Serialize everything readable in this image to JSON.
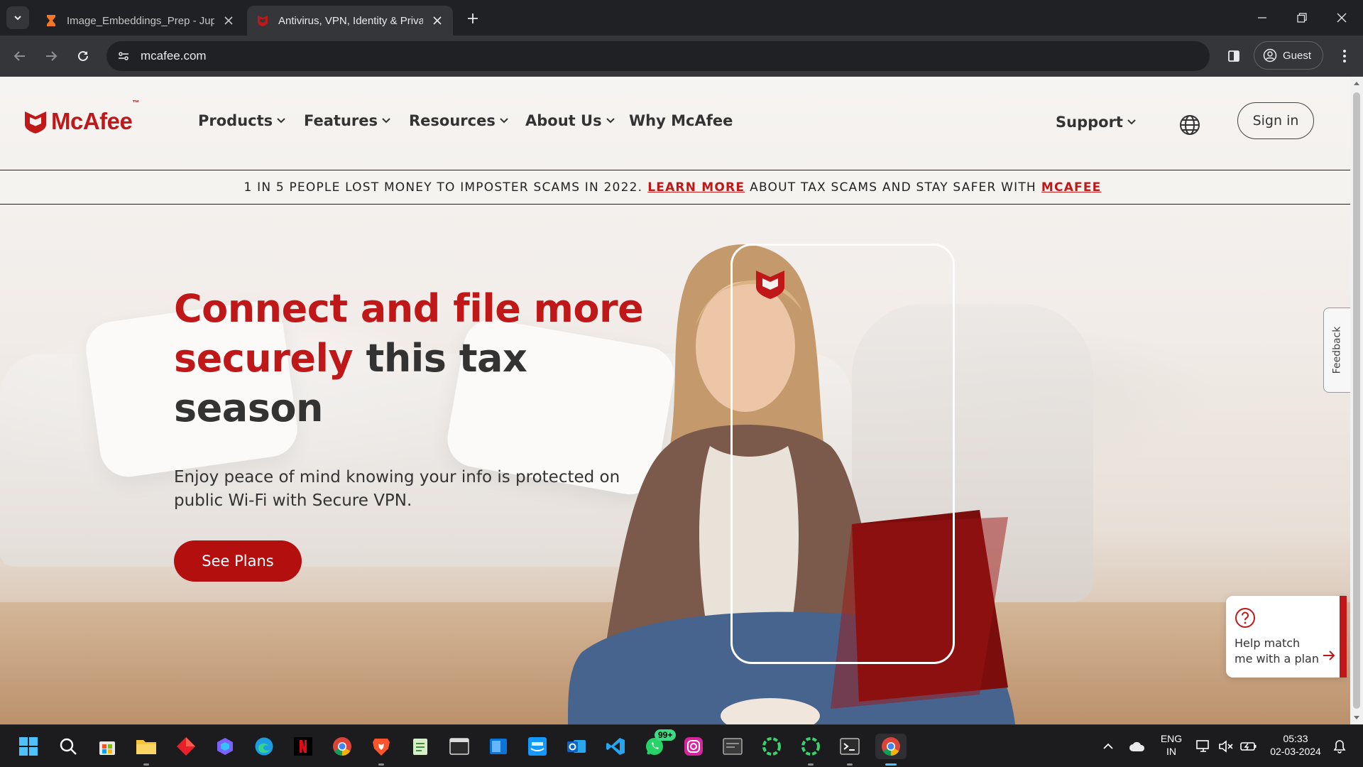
{
  "browser": {
    "tabs": [
      {
        "title": "Image_Embeddings_Prep - Jupyter",
        "active": false
      },
      {
        "title": "Antivirus, VPN, Identity & Privacy",
        "active": true
      }
    ],
    "url": "mcafee.com",
    "profile_label": "Guest"
  },
  "site": {
    "logo_text": "McAfee",
    "logo_tm": "™",
    "nav": {
      "products": "Products",
      "features": "Features",
      "resources": "Resources",
      "about": "About Us",
      "why": "Why McAfee",
      "support": "Support",
      "signin": "Sign in"
    },
    "banner": {
      "text_before": "1 IN 5 PEOPLE LOST MONEY TO IMPOSTER SCAMS IN 2022.",
      "link1": "LEARN MORE",
      "text_middle": "ABOUT TAX SCAMS AND STAY SAFER WITH",
      "link2": "MCAFEE"
    },
    "hero": {
      "title_red": "Connect and file more securely",
      "title_dark": "this tax season",
      "subtitle": "Enjoy peace of mind knowing your info is protected on public Wi-Fi with Secure VPN.",
      "cta": "See Plans"
    },
    "feedback_label": "Feedback",
    "help_card_text": "Help match me with a plan",
    "brand_color": "#c01818"
  },
  "taskbar": {
    "whatsapp_badge": "99+",
    "lang_line1": "ENG",
    "lang_line2": "IN",
    "time": "05:33",
    "date": "02-03-2024"
  }
}
